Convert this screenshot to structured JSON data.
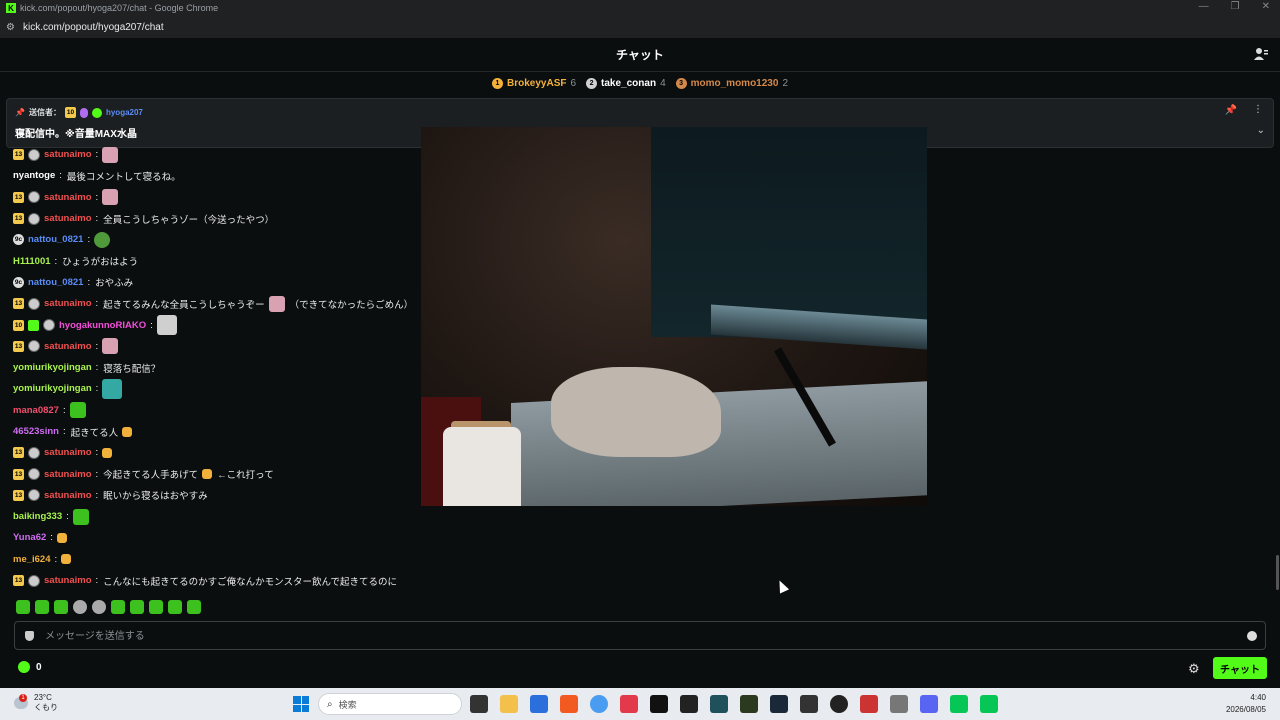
{
  "window": {
    "title": "kick.com/popout/hyoga207/chat - Google Chrome",
    "url": "kick.com/popout/hyoga207/chat"
  },
  "header": {
    "title": "チャット"
  },
  "leaderboard": [
    {
      "rank": "1",
      "name": "BrokeyyASF",
      "count": "6",
      "color": "#f2b13b",
      "name_color": "#f2b13b"
    },
    {
      "rank": "2",
      "name": "take_conan",
      "count": "4",
      "color": "#d0d0d0",
      "name_color": "#ffffff"
    },
    {
      "rank": "3",
      "name": "momo_momo1230",
      "count": "2",
      "color": "#d4894a",
      "name_color": "#d4894a"
    }
  ],
  "pinned": {
    "label": "送信者：",
    "sub_months": "10",
    "user": "hyoga207",
    "message": "寝配信中。※音量MAX水晶"
  },
  "messages": [
    {
      "badges": [
        "13",
        "og"
      ],
      "user": "satunaimo",
      "color": "#f24f4f",
      "text": "",
      "emote": "pink"
    },
    {
      "badges": [],
      "user": "nyantoge",
      "color": "#ffffff",
      "text": "最後コメントして寝るね。"
    },
    {
      "badges": [
        "13",
        "og"
      ],
      "user": "satunaimo",
      "color": "#f24f4f",
      "text": "",
      "emote": "pink"
    },
    {
      "badges": [
        "13",
        "og"
      ],
      "user": "satunaimo",
      "color": "#f24f4f",
      "text": "全員こうしちゃうゾー（今送ったやつ）"
    },
    {
      "badges": [
        "9c"
      ],
      "user": "nattou_0821",
      "color": "#5b8cf5",
      "text": "",
      "emote": "frog"
    },
    {
      "badges": [],
      "user": "H111001",
      "color": "#a8f24f",
      "text": "ひょうがおはよう"
    },
    {
      "badges": [
        "9c"
      ],
      "user": "nattou_0821",
      "color": "#5b8cf5",
      "text": "おやふみ"
    },
    {
      "badges": [
        "13",
        "og"
      ],
      "user": "satunaimo",
      "color": "#f24f4f",
      "text": "起きてるみんな全員こうしちゃうぞー",
      "emote": "pink",
      "suffix": "（できてなかったらごめん）"
    },
    {
      "badges": [
        "10",
        "gift",
        "og"
      ],
      "user": "hyogakunnoRIAKO",
      "color": "#f24fd8",
      "text": "",
      "emote": "gray"
    },
    {
      "badges": [
        "13",
        "og"
      ],
      "user": "satunaimo",
      "color": "#f24f4f",
      "text": "",
      "emote": "pink"
    },
    {
      "badges": [],
      "user": "yomiurikyojingan",
      "color": "#a8f24f",
      "text": "寝落ち配信？"
    },
    {
      "badges": [],
      "user": "yomiurikyojingan",
      "color": "#a8f24f",
      "text": "",
      "emote": "teal"
    },
    {
      "badges": [],
      "user": "mana0827",
      "color": "#f24f6f",
      "text": "",
      "emote": "green"
    },
    {
      "badges": [],
      "user": "46523sinn",
      "color": "#d06cf2",
      "text": "起きてる人",
      "hand": true
    },
    {
      "badges": [
        "13",
        "og"
      ],
      "user": "satunaimo",
      "color": "#f24f4f",
      "text": "",
      "hand": true
    },
    {
      "badges": [
        "13",
        "og"
      ],
      "user": "satunaimo",
      "color": "#f24f4f",
      "text": "今起きてる人手あげて",
      "hand": true,
      "suffix": "←これ打って"
    },
    {
      "badges": [
        "13",
        "og"
      ],
      "user": "satunaimo",
      "color": "#f24f4f",
      "text": "眠いから寝るはおやすみ"
    },
    {
      "badges": [],
      "user": "baiking333",
      "color": "#a8f24f",
      "text": "",
      "emote": "green"
    },
    {
      "badges": [],
      "user": "Yuna62",
      "color": "#d06cf2",
      "text": "",
      "hand": true
    },
    {
      "badges": [],
      "user": "me_i624",
      "color": "#f2b13b",
      "text": "",
      "hand": true
    },
    {
      "badges": [
        "13",
        "og"
      ],
      "user": "satunaimo",
      "color": "#f24f4f",
      "text": "こんなにも起きてるのかすご俺なんかモンスター飲んで起きてるのに"
    }
  ],
  "emote_bar_count": 10,
  "input": {
    "placeholder": "メッセージを送信する",
    "value": ""
  },
  "footer": {
    "points": "0",
    "send_label": "チャット"
  },
  "taskbar": {
    "temp": "23°C",
    "weather": "くもり",
    "notif": "1",
    "search": "検索",
    "time": "4:40",
    "date": "2026/08/05"
  },
  "colors": {
    "accent": "#53fc18",
    "background": "#0b0e0f"
  }
}
